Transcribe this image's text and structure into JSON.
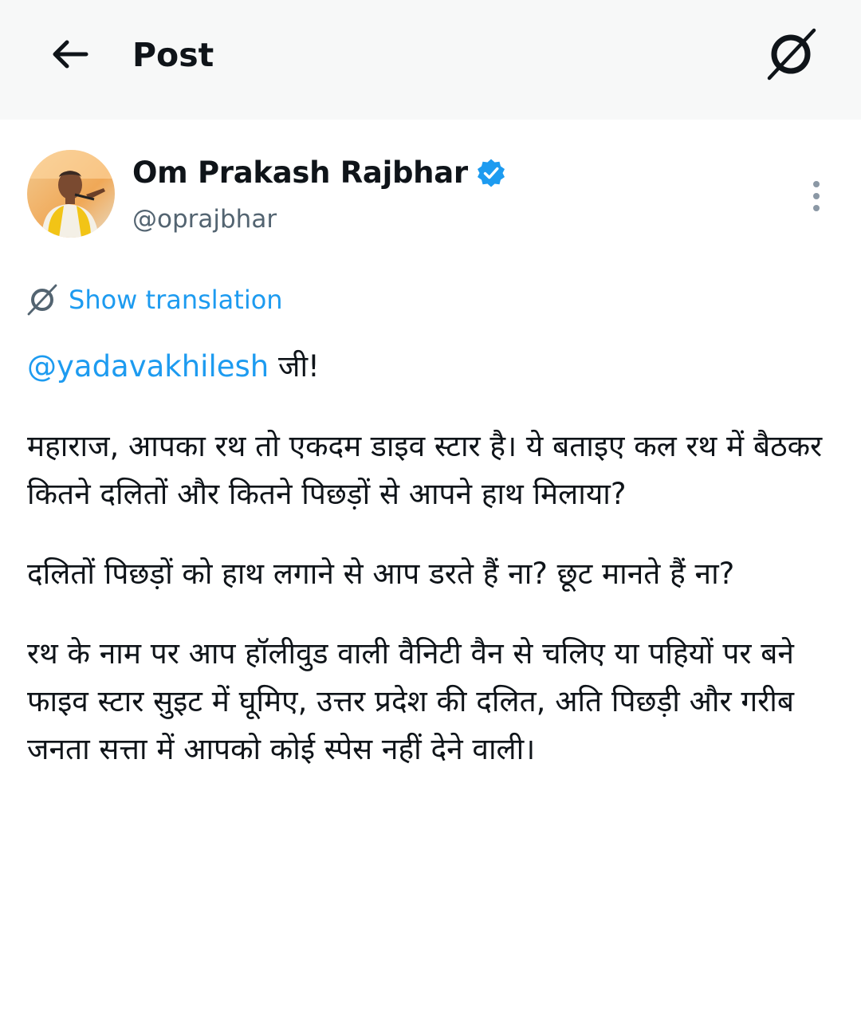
{
  "header": {
    "title": "Post",
    "back_icon": "arrow-left-icon",
    "translate_icon": "translate-slash-icon"
  },
  "author": {
    "display_name": "Om Prakash Rajbhar",
    "handle": "@oprajbhar",
    "verified_icon": "verified-badge-icon",
    "verified_color": "#1d9bf0"
  },
  "translation": {
    "label": "Show translation",
    "icon": "translate-slash-icon"
  },
  "post": {
    "mention": "@yadavakhilesh",
    "greeting": " जी!",
    "paragraphs": [
      "महाराज, आपका रथ तो एकदम डाइव स्टार है। ये बताइए कल रथ में बैठकर कितने दलितों और कितने पिछड़ों से आपने हाथ मिलाया?",
      "दलितों पिछड़ों को हाथ लगाने से आप डरते हैं ना? छूट मानते हैं ना?",
      "रथ के नाम पर आप हॉलीवुड वाली वैनिटी वैन से चलिए या पहियों पर बने फाइव स्टार सुइट में घूमिए, उत्तर प्रदेश की दलित, अति पिछड़ी और गरीब जनता सत्ता में आपको कोई स्पेस नहीं देने वाली।"
    ]
  },
  "colors": {
    "accent": "#1d9bf0",
    "text_primary": "#0f1419",
    "text_secondary": "#536471",
    "header_bg": "#f7f8f8"
  }
}
